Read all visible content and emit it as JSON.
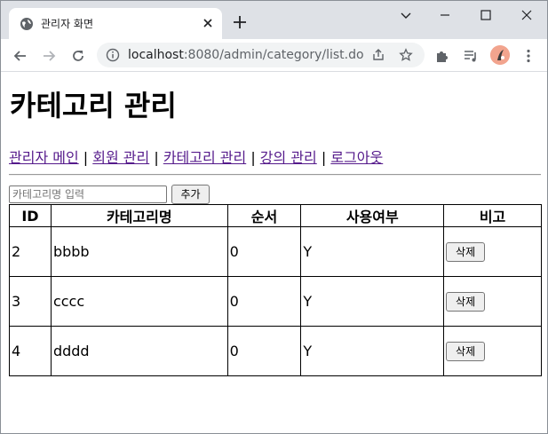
{
  "browser": {
    "tab_title": "관리자 화면",
    "url_host": "localhost",
    "url_port": ":8080",
    "url_path": "/admin/category/list.do"
  },
  "page": {
    "title": "카테고리 관리",
    "nav": [
      {
        "label": "관리자 메인"
      },
      {
        "label": "회원 관리"
      },
      {
        "label": "카테고리 관리"
      },
      {
        "label": "강의 관리"
      },
      {
        "label": "로그아웃"
      }
    ],
    "separator": "|",
    "form": {
      "input_placeholder": "카테고리명 입력",
      "input_value": "",
      "add_label": "추가"
    },
    "table": {
      "headers": [
        "ID",
        "카테고리명",
        "순서",
        "사용여부",
        "비고"
      ],
      "rows": [
        {
          "id": "2",
          "name": "bbbb",
          "order": "0",
          "use": "Y",
          "action": "삭제"
        },
        {
          "id": "3",
          "name": "cccc",
          "order": "0",
          "use": "Y",
          "action": "삭제"
        },
        {
          "id": "4",
          "name": "dddd",
          "order": "0",
          "use": "Y",
          "action": "삭제"
        }
      ]
    }
  },
  "icons": {
    "favicon": "globe-icon",
    "tab_close": "close-icon",
    "new_tab": "plus-icon",
    "minimize": "minimize-icon",
    "maximize": "maximize-icon",
    "close_window": "close-icon",
    "dropdown": "chevron-down-icon",
    "back": "back-arrow-icon",
    "forward": "forward-arrow-icon",
    "reload": "reload-icon",
    "info": "info-icon",
    "share": "share-icon",
    "bookmark": "star-icon",
    "extensions": "puzzle-icon",
    "media": "media-queue-icon",
    "profile": "avatar",
    "menu": "kebab-menu-icon"
  },
  "colors": {
    "tabstrip_bg": "#dee1e6",
    "omnibox_bg": "#f1f3f4",
    "visited_link": "#551a8b"
  }
}
